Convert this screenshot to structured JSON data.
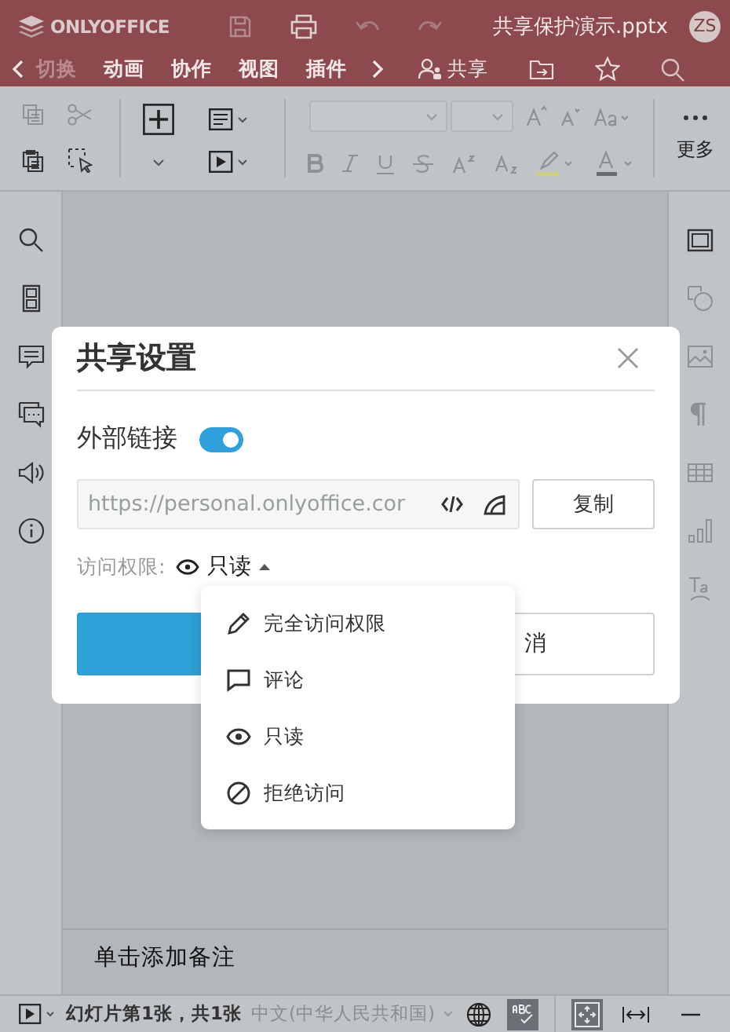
{
  "header": {
    "logo": "ONLYOFFICE",
    "document_title": "共享保护演示.pptx",
    "user_initials": "ZS"
  },
  "tabs": [
    {
      "label": "切换",
      "faded": true
    },
    {
      "label": "动画",
      "faded": false
    },
    {
      "label": "协作",
      "faded": false
    },
    {
      "label": "视图",
      "faded": false
    },
    {
      "label": "插件",
      "faded": false
    }
  ],
  "share_button": "共享",
  "toolbar": {
    "more_label": "更多"
  },
  "notes": {
    "placeholder": "单击添加备注"
  },
  "status_bar": {
    "slide_info": "幻灯片第1张，共1张",
    "language": "中文(中华人民共和国)",
    "spellcheck": true,
    "fit_slide": true
  },
  "dialog": {
    "title": "共享设置",
    "external_link_label": "外部链接",
    "external_link_on": true,
    "link_value": "https://personal.onlyoffice.cor",
    "copy_button": "复制",
    "access_label": "访问权限:",
    "access_value": "只读",
    "cancel_button": "消"
  },
  "access_menu": {
    "open": true,
    "items": [
      {
        "label": "完全访问权限"
      },
      {
        "label": "评论"
      },
      {
        "label": "只读"
      },
      {
        "label": "拒绝访问"
      }
    ]
  }
}
